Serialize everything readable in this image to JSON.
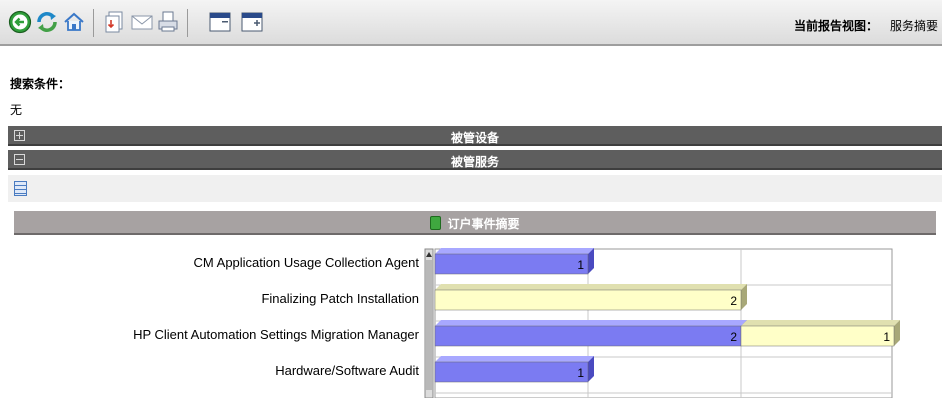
{
  "toolbar": {
    "icons": [
      "back-icon",
      "refresh-icon",
      "home-icon",
      "export-icon",
      "email-icon",
      "print-icon",
      "expand-window-icon",
      "add-window-icon"
    ],
    "current_view_label": "当前报告视图：",
    "current_view_value": "服务摘要"
  },
  "search": {
    "label": "搜索条件：",
    "value": "无"
  },
  "sections": [
    {
      "title": "被管设备",
      "state": "collapsed"
    },
    {
      "title": "被管服务",
      "state": "expanded"
    }
  ],
  "chart_header": {
    "title": "订户事件摘要"
  },
  "colors": {
    "series_blue": "#7b7bf2",
    "series_yellow": "#ffffc8",
    "header_bar": "#5e5e5e",
    "chart_header_bar": "#a7a2a2"
  },
  "chart_data": {
    "type": "bar",
    "orientation": "horizontal",
    "stacked": true,
    "categories": [
      "CM Application Usage Collection Agent",
      "Finalizing Patch Installation",
      "HP Client Automation Settings Migration Manager",
      "Hardware/Software Audit"
    ],
    "series": [
      {
        "values": [
          1,
          0,
          2,
          1
        ],
        "color": "#7b7bf2"
      },
      {
        "values": [
          0,
          2,
          1,
          0
        ],
        "color": "#ffffc8"
      }
    ],
    "xlim": [
      0,
      3
    ],
    "grid": true
  }
}
